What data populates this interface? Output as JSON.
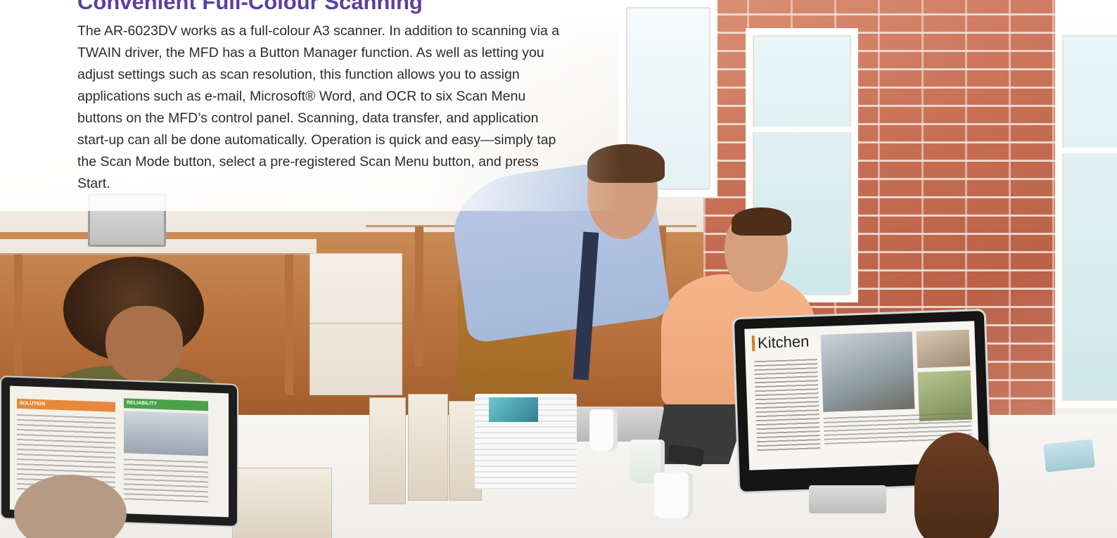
{
  "section": {
    "heading": "Convenient Full-Colour Scanning",
    "body": "The AR-6023DV works as a full-colour A3 scanner. In addition to scanning via a TWAIN driver, the MFD has a Button Manager function. As well as letting you adjust settings such as scan resolution, this function allows you to assign applications such as e-mail, Microsoft® Word, and OCR to six Scan Menu buttons on the MFD’s control panel. Scanning, data transfer, and application start-up can all be done automatically. Operation is quick and easy—simply tap the Scan Mode button, select a pre-registered Scan Menu button, and press Start."
  },
  "photo": {
    "monitor_left": {
      "banner_left": "SOLUTION",
      "banner_right": "RELIABILITY"
    },
    "monitor_right": {
      "title": "Kitchen"
    }
  },
  "colors": {
    "heading": "#5b3fa0",
    "body_text": "#2b2b2b",
    "brick": "#c4674c"
  }
}
